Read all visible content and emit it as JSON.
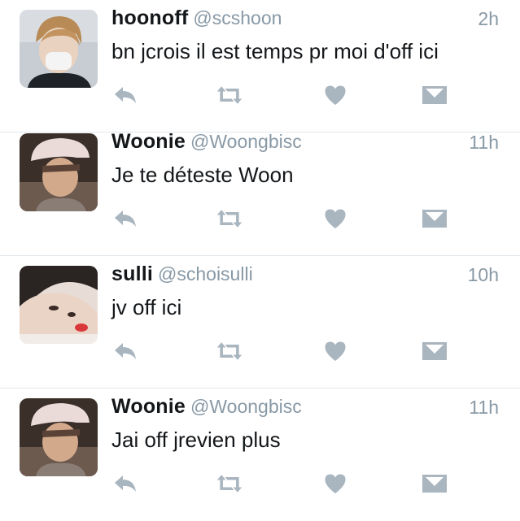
{
  "colors": {
    "text": "#14171a",
    "secondary": "#8899a6",
    "icon": "#a9b5bf",
    "divider": "#e1e8ed",
    "background": "#ffffff"
  },
  "icons": [
    "reply-icon",
    "retweet-icon",
    "heart-icon",
    "direct-message-icon"
  ],
  "tweets": [
    {
      "display_name": "hoonoff",
      "handle": "@scshoon",
      "time": "2h",
      "text": "bn jcrois il est temps pr moi d'off ici"
    },
    {
      "display_name": "Woonie",
      "handle": "@Woongbisc",
      "time": "11h",
      "text": "Je te déteste Woon"
    },
    {
      "display_name": "sulli",
      "handle": "@schoisulli",
      "time": "10h",
      "text": "jv off ici"
    },
    {
      "display_name": "Woonie",
      "handle": "@Woongbisc",
      "time": "11h",
      "text": "Jai off jrevien plus"
    }
  ]
}
